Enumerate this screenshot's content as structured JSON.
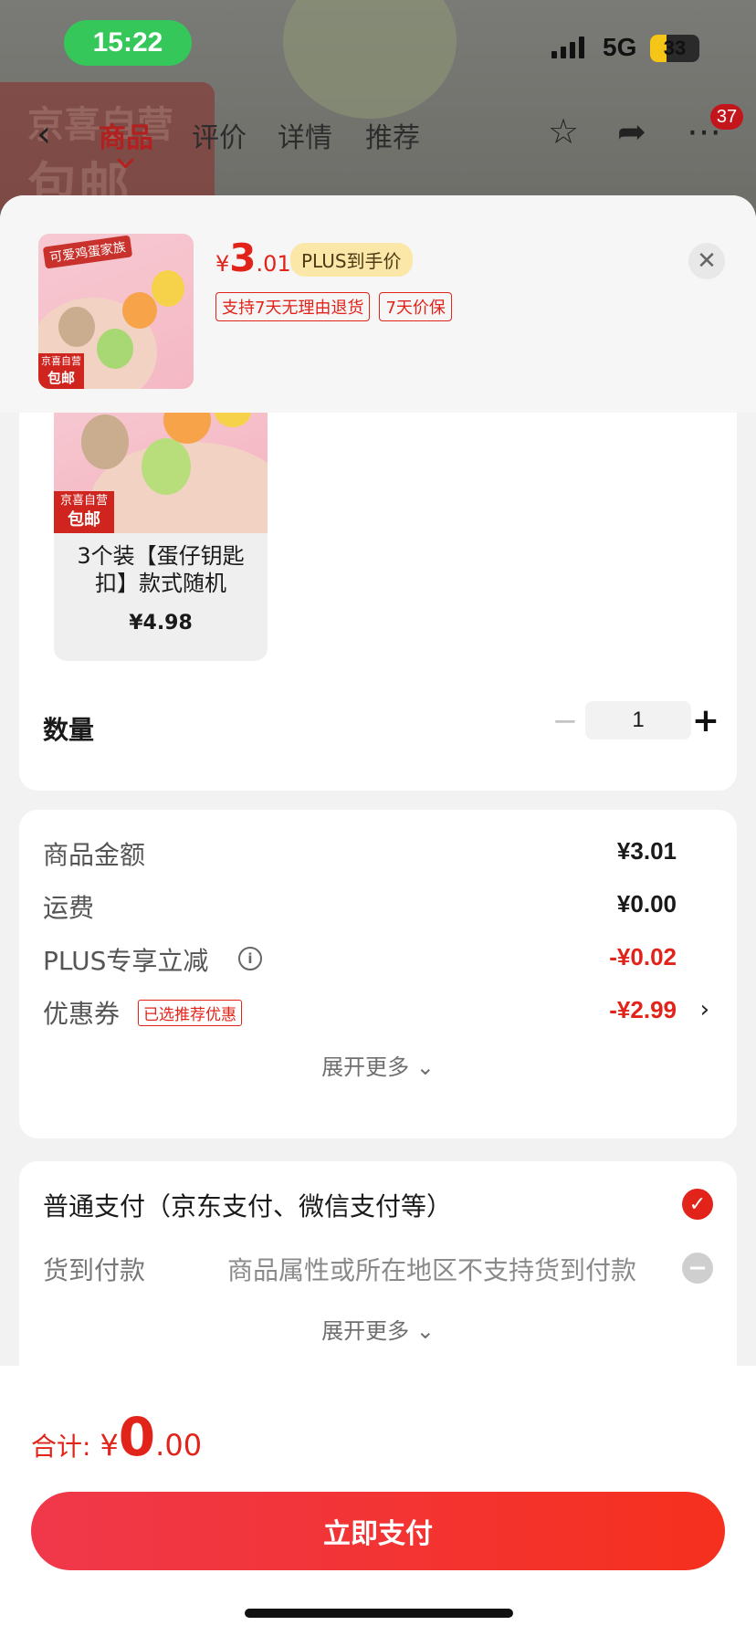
{
  "status_bar": {
    "time": "15:22",
    "network": "5G",
    "battery": "33",
    "battery_level": 0.33
  },
  "background_page": {
    "badge_line1": "京喜自营",
    "badge_line2": "包邮",
    "tabs": [
      "商品",
      "评价",
      "详情",
      "推荐"
    ],
    "active_tab": "商品",
    "message_count": "37"
  },
  "sheet": {
    "price": {
      "currency": "¥",
      "integer": "3",
      "decimal": ".01"
    },
    "plus_tag": "PLUS到手价",
    "service_tags": [
      "支持7天无理由退货",
      "7天价保"
    ],
    "thumbnail": {
      "banner": "可爱鸡蛋家族",
      "badge_line1": "京喜自营",
      "badge_line2": "包邮"
    }
  },
  "spec": {
    "name": "3个装【蛋仔钥匙扣】款式随机",
    "price": "¥4.98",
    "badge_line1": "京喜自营",
    "badge_line2": "包邮"
  },
  "quantity": {
    "label": "数量",
    "value": "1",
    "minus": "−",
    "plus": "+"
  },
  "costs": {
    "rows": [
      {
        "label": "商品金额",
        "value": "¥3.01"
      },
      {
        "label": "运费",
        "value": "¥0.00"
      },
      {
        "label": "PLUS专享立减",
        "value": "-¥0.02"
      },
      {
        "label": "优惠券",
        "tag": "已选推荐优惠",
        "value": "-¥2.99"
      }
    ],
    "expand": "展开更多"
  },
  "payment": {
    "main": "普通支付（京东支付、微信支付等）",
    "cod_label": "货到付款",
    "cod_note": "商品属性或所在地区不支持货到付款",
    "expand": "展开更多"
  },
  "footer": {
    "total_label": "合计:",
    "total_currency": "¥",
    "total_integer": "0",
    "total_decimal": ".00",
    "pay_button": "立即支付"
  },
  "colors": {
    "accent": "#e2231a",
    "status_green": "#35c759",
    "plus_tag_bg": "#fbe7a8"
  },
  "icons": [
    "back-icon",
    "star-icon",
    "share-icon",
    "more-icon",
    "close-icon",
    "info-icon",
    "chevron-right-icon",
    "chevron-down-icon",
    "check-icon",
    "disabled-icon"
  ]
}
